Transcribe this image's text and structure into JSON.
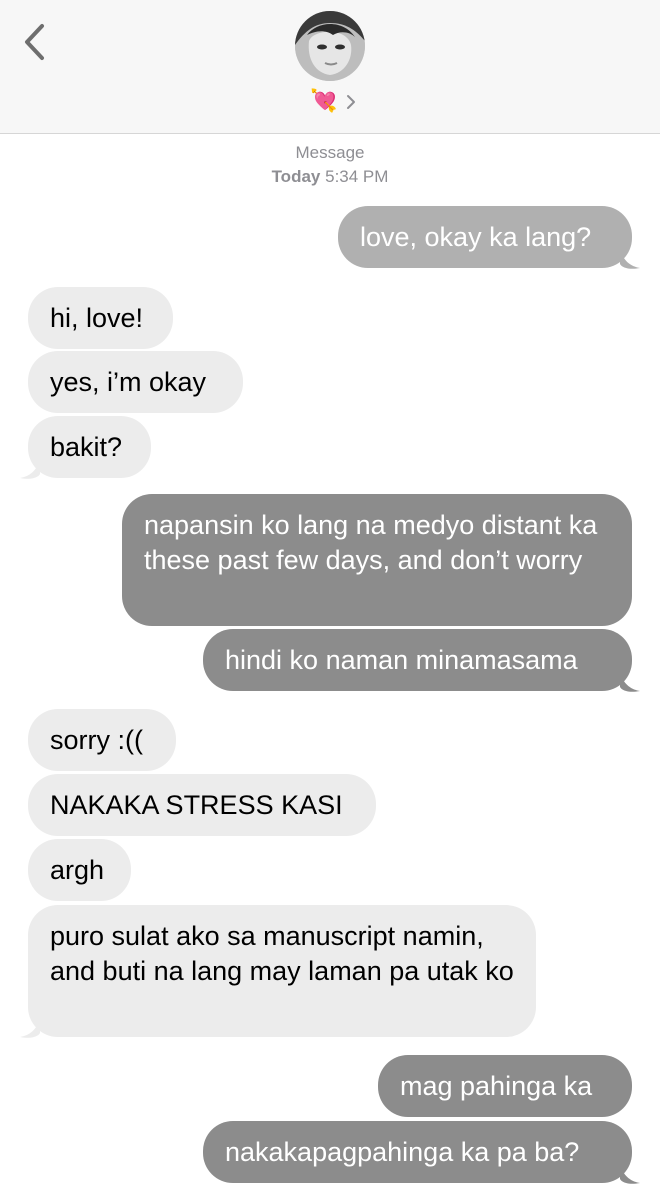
{
  "header": {
    "contact_emoji": "💘",
    "back_icon": "chevron-left-icon",
    "detail_icon": "chevron-right-icon"
  },
  "timestamp": {
    "label": "Message",
    "day": "Today",
    "time": "5:34 PM"
  },
  "messages": [
    {
      "direction": "sent",
      "text": "love, okay ka lang?"
    },
    {
      "direction": "received",
      "text": "hi, love!"
    },
    {
      "direction": "received",
      "text": "yes, i’m okay"
    },
    {
      "direction": "received",
      "text": "bakit?"
    },
    {
      "direction": "sent",
      "text": "napansin ko lang na medyo distant ka these past few days, and don’t worry"
    },
    {
      "direction": "sent",
      "text": "hindi ko naman minamasama"
    },
    {
      "direction": "received",
      "text": "sorry :(("
    },
    {
      "direction": "received",
      "text": "NAKAKA STRESS KASI"
    },
    {
      "direction": "received",
      "text": "argh"
    },
    {
      "direction": "received",
      "text": "puro sulat ako sa manuscript namin, and buti na lang may laman pa utak ko"
    },
    {
      "direction": "sent",
      "text": "mag pahinga ka"
    },
    {
      "direction": "sent",
      "text": "nakakapagpahinga ka pa ba?"
    }
  ],
  "colors": {
    "sent_bubble": "#8c8c8c",
    "sent_bubble_light": "#b0b0b0",
    "received_bubble": "#ececec",
    "header_bg": "#f7f7f7"
  }
}
